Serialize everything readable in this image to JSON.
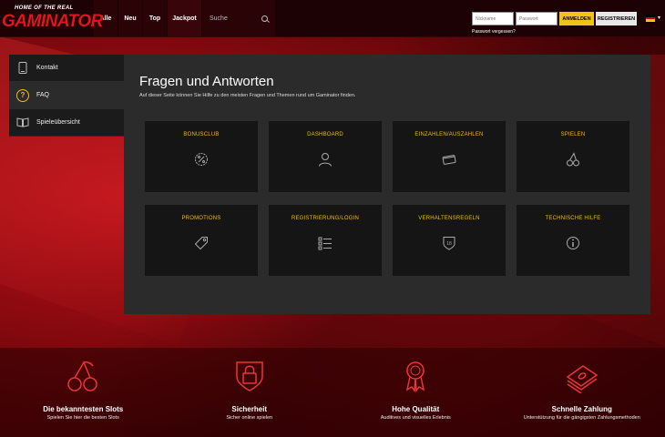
{
  "header": {
    "tagline": "HOME OF THE REAL",
    "brand": "GAMINATOR",
    "nav": [
      "Alle",
      "Neu",
      "Top",
      "Jackpot"
    ],
    "search_placeholder": "Suche",
    "nickname_placeholder": "Nickname",
    "password_placeholder": "Passwort",
    "login_label": "ANMELDEN",
    "register_label": "REGISTRIEREN",
    "forgot_password": "Passwort vergessen?"
  },
  "sidebar": {
    "items": [
      {
        "label": "Kontakt",
        "icon": "phone-icon"
      },
      {
        "label": "FAQ",
        "icon": "question-icon"
      },
      {
        "label": "Spieleübersicht",
        "icon": "book-icon"
      }
    ]
  },
  "main": {
    "title": "Fragen und Antworten",
    "subtitle": "Auf dieser Seite können Sie Hilfe zu den meisten Fragen und Themen rund um Gaminator finden.",
    "cards": [
      {
        "label": "BONUSCLUB",
        "icon": "percent-badge-icon"
      },
      {
        "label": "DASHBOARD",
        "icon": "user-icon"
      },
      {
        "label": "EINZAHLEN/AUSZAHLEN",
        "icon": "credit-card-icon"
      },
      {
        "label": "SPIELEN",
        "icon": "cherries-icon"
      },
      {
        "label": "PROMOTIONS",
        "icon": "tag-icon"
      },
      {
        "label": "REGISTRIERUNG/LOGIN",
        "icon": "checklist-icon"
      },
      {
        "label": "VERHALTENSREGELN",
        "icon": "age-18-shield-icon"
      },
      {
        "label": "TECHNISCHE HILFE",
        "icon": "info-icon"
      }
    ]
  },
  "footer": {
    "features": [
      {
        "title": "Die bekanntesten Slots",
        "subtitle": "Spielen Sie hier die besten Slots",
        "icon": "cherries-icon"
      },
      {
        "title": "Sicherheit",
        "subtitle": "Sicher online spielen",
        "icon": "lock-shield-icon"
      },
      {
        "title": "Hohe Qualität",
        "subtitle": "Auditives und visuelles Erlebnis",
        "icon": "award-ribbon-icon"
      },
      {
        "title": "Schnelle Zahlung",
        "subtitle": "Unterstützung für die gängigsten Zahlungsmethoden",
        "icon": "money-stack-icon"
      }
    ]
  },
  "colors": {
    "accent": "#f1b91a",
    "brand_red": "#e3141c",
    "panel": "#2b2b2b",
    "card": "#151515"
  }
}
